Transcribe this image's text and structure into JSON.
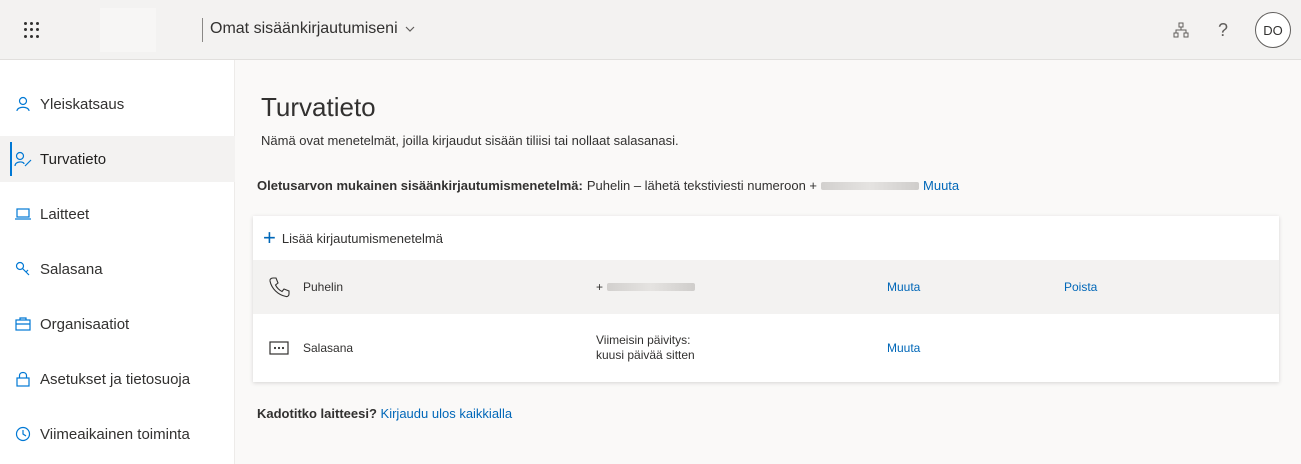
{
  "header": {
    "app_title": "Omat sisäänkirjautumiseni",
    "avatar_initials": "DO",
    "help_glyph": "?"
  },
  "sidebar": {
    "items": [
      {
        "label": "Yleiskatsaus",
        "icon": "person-icon"
      },
      {
        "label": "Turvatieto",
        "icon": "security-info-icon",
        "active": true
      },
      {
        "label": "Laitteet",
        "icon": "laptop-icon"
      },
      {
        "label": "Salasana",
        "icon": "key-icon"
      },
      {
        "label": "Organisaatiot",
        "icon": "briefcase-icon"
      },
      {
        "label": "Asetukset ja tietosuoja",
        "icon": "lock-icon"
      },
      {
        "label": "Viimeaikainen toiminta",
        "icon": "history-icon"
      }
    ]
  },
  "main": {
    "title": "Turvatieto",
    "subtitle": "Nämä ovat menetelmät, joilla kirjaudut sisään tiliisi tai nollaat salasanasi.",
    "default_method_label": "Oletusarvon mukainen sisäänkirjautumismenetelmä:",
    "default_method_value": "Puhelin – lähetä tekstiviesti numeroon +",
    "default_method_change": "Muuta",
    "add_method": "Lisää kirjautumismenetelmä",
    "methods": [
      {
        "name": "Puhelin",
        "detail": "+",
        "change": "Muuta",
        "delete": "Poista"
      },
      {
        "name": "Salasana",
        "detail_line1": "Viimeisin päivitys:",
        "detail_line2": "kuusi päivää sitten",
        "change": "Muuta"
      }
    ],
    "lost_device_question": "Kadotitko laitteesi?",
    "lost_device_link": "Kirjaudu ulos kaikkialla"
  },
  "colors": {
    "accent": "#0078d4",
    "link": "#0067b8",
    "topbar_bg": "#f3f2f1",
    "main_bg": "#faf9f8"
  }
}
